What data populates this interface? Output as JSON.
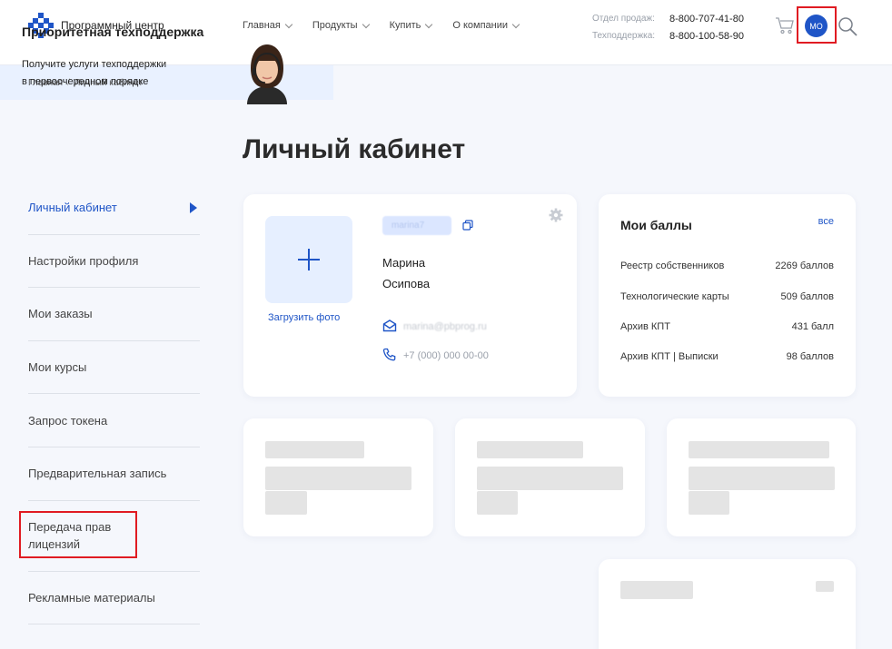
{
  "header": {
    "logo_text": "Программный центр",
    "nav": [
      {
        "label": "Главная"
      },
      {
        "label": "Продукты"
      },
      {
        "label": "Купить"
      },
      {
        "label": "О компании"
      }
    ],
    "contacts": [
      {
        "label": "Отдел продаж:",
        "phone": "8-800-707-41-80"
      },
      {
        "label": "Техподдержка:",
        "phone": "8-800-100-58-90"
      }
    ],
    "avatar_initials": "МО"
  },
  "breadcrumb": [
    "Главная",
    "Личный кабинет"
  ],
  "page_title": "Личный кабинет",
  "sidebar": {
    "items": [
      {
        "label": "Личный кабинет",
        "active": true
      },
      {
        "label": "Настройки профиля"
      },
      {
        "label": "Мои заказы"
      },
      {
        "label": "Мои курсы"
      },
      {
        "label": "Запрос токена"
      },
      {
        "label": "Предварительная запись"
      },
      {
        "label": "Передача прав лицензий"
      },
      {
        "label": "Рекламные материалы"
      }
    ]
  },
  "profile": {
    "upload_label": "Загрузить фото",
    "login": "marina7",
    "first_name": "Марина",
    "last_name": "Осипова",
    "email": "marina@pbprog.ru",
    "phone": "+7 (000) 000 00-00"
  },
  "points": {
    "title": "Мои баллы",
    "all_link": "все",
    "rows": [
      {
        "name": "Реестр собственников",
        "value": "2269 баллов"
      },
      {
        "name": "Технологические карты",
        "value": "509 баллов"
      },
      {
        "name": "Архив КПТ",
        "value": "431 балл"
      },
      {
        "name": "Архив КПТ | Выписки",
        "value": "98 баллов"
      }
    ]
  },
  "support": {
    "title": "Приоритетная техподдержка",
    "text_line1": "Получите услуги техподдержки",
    "text_line2": "в первоочередном порядке"
  },
  "colors": {
    "accent": "#1f55c7",
    "highlight": "#e01b22",
    "background": "#f5f7fc"
  }
}
